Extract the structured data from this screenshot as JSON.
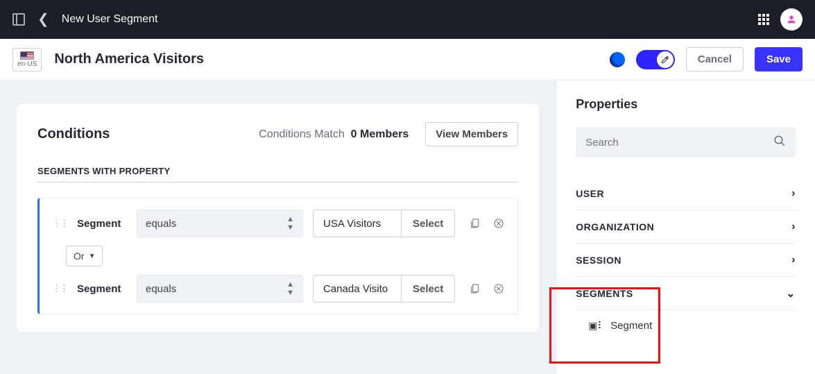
{
  "topbar": {
    "title": "New User Segment"
  },
  "titlebar": {
    "locale": "en-US",
    "heading": "North America Visitors",
    "cancel": "Cancel",
    "save": "Save"
  },
  "conditions": {
    "title": "Conditions",
    "match_label": "Conditions Match",
    "match_count": "0 Members",
    "view_btn": "View Members",
    "section_label": "SEGMENTS WITH PROPERTY",
    "or_label": "Or",
    "rules": [
      {
        "field": "Segment",
        "operator": "equals",
        "value": "USA Visitors",
        "select": "Select"
      },
      {
        "field": "Segment",
        "operator": "equals",
        "value": "Canada Visito",
        "select": "Select"
      }
    ]
  },
  "panel": {
    "title": "Properties",
    "search_placeholder": "Search",
    "categories": [
      {
        "label": "USER",
        "open": false
      },
      {
        "label": "ORGANIZATION",
        "open": false
      },
      {
        "label": "SESSION",
        "open": false
      },
      {
        "label": "SEGMENTS",
        "open": true,
        "item": "Segment"
      }
    ]
  }
}
